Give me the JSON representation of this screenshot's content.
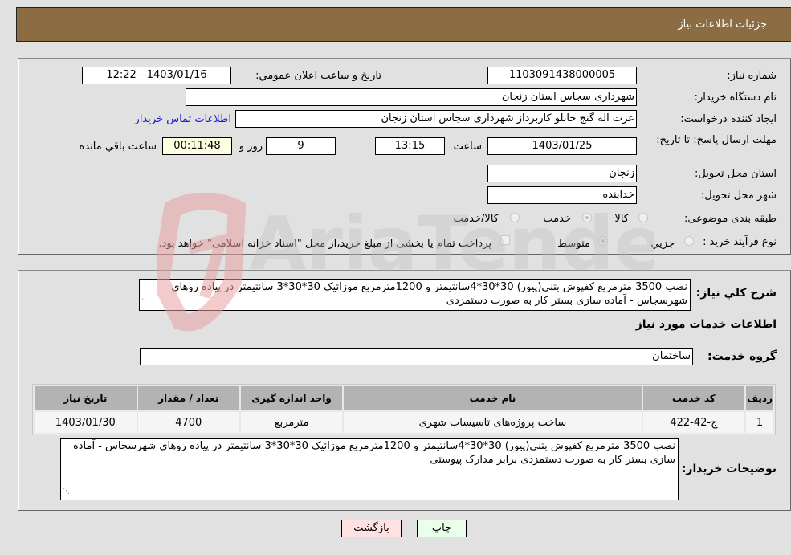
{
  "header": {
    "title": "جزئیات اطلاعات نیاز"
  },
  "form": {
    "need_number_label": "شماره نیاز:",
    "need_number": "1103091438000005",
    "announce_label": "تاریخ و ساعت اعلان عمومي:",
    "announce_value": "1403/01/16 - 12:22",
    "buyer_org_label": "نام دستگاه خريدار:",
    "buyer_org": "شهرداری سجاس استان زنجان",
    "creator_label": "ایجاد کننده درخواست:",
    "creator": "عزت اله گنج خانلو کاربرداز شهرداری سجاس استان زنجان",
    "contact_link": "اطلاعات تماس خريدار",
    "deadline_label": "مهلت ارسال پاسخ: تا تاریخ:",
    "deadline_date": "1403/01/25",
    "time_label": "ساعت",
    "deadline_time": "13:15",
    "days_value": "9",
    "days_label": "روز و",
    "remaining_time": "00:11:48",
    "remaining_label": "ساعت باقي مانده",
    "province_label": "استان محل تحویل:",
    "province": "زنجان",
    "city_label": "شهر محل تحویل:",
    "city": "خدابنده",
    "category_label": "طبقه بندی موضوعی:",
    "category_options": [
      {
        "label": "كالا",
        "checked": false
      },
      {
        "label": "خدمت",
        "checked": true
      },
      {
        "label": "كالا/خدمت",
        "checked": false
      }
    ],
    "process_label": "نوع فرآیند خرید :",
    "process_options": [
      {
        "label": "جزيي",
        "checked": false
      },
      {
        "label": "متوسط",
        "checked": true
      }
    ],
    "treasury_note": "پرداخت تمام یا بخشی از مبلغ خرید،از محل \"اسناد خزانه اسلامی\" خواهد بود.",
    "treasury_checked": false
  },
  "details": {
    "summary_label": "شرح كلي نياز:",
    "summary": "نصب 3500 مترمربع کفپوش بتنی(پیور) 30*30*4سانتیمتر و 1200مترمربع موزائیک 30*30*3 سانتیمتر در پیاده روهای شهرسجاس - آماده سازی بستر کار به صورت دستمزدی",
    "services_title": "اطلاعات خدمات مورد نياز",
    "service_group_label": "گروه خدمت:",
    "service_group": "ساختمان",
    "table": {
      "headers": [
        "رديف",
        "كد خدمت",
        "نام خدمت",
        "واحد اندازه گيری",
        "تعداد / مقدار",
        "تاريخ نياز"
      ],
      "rows": [
        [
          "1",
          "ج-42-422",
          "ساخت پروژه‌های تاسیسات شهری",
          "مترمربع",
          "4700",
          "1403/01/30"
        ]
      ]
    },
    "buyer_notes_label": "توضيحات خريدار:",
    "buyer_notes": "نصب 3500 مترمربع کفپوش بتنی(پیور) 30*30*4سانتیمتر و 1200مترمربع موزائیک 30*30*3 سانتیمتر در پیاده روهای شهرسجاس - آماده سازی بستر کار به صورت دستمزدی برابر مدارک پیوستی"
  },
  "buttons": {
    "print": "چاپ",
    "back": "بازگشت"
  },
  "colors": {
    "header_bg": "#8b6c43",
    "print_bg": "#eaffea",
    "back_bg": "#ffe1e1",
    "link": "#1a1acc"
  },
  "watermark": {
    "text": "AriaTender.neT"
  }
}
